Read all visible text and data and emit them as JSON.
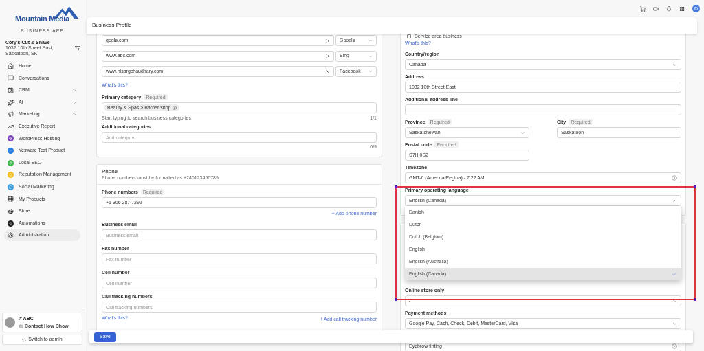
{
  "topbar": {
    "avatar": "D"
  },
  "sidebar": {
    "brand": "Mountain Media",
    "tagline": "BUSINESS APP",
    "account": {
      "name": "Cory's Cut & Shave",
      "address": "1032 10th Street East, Saskatoon, SK"
    },
    "items": [
      {
        "label": "Home",
        "expandable": false,
        "selected": false
      },
      {
        "label": "Conversations",
        "expandable": false,
        "selected": false
      },
      {
        "label": "CRM",
        "expandable": true,
        "selected": false
      },
      {
        "label": "AI",
        "expandable": true,
        "selected": false
      },
      {
        "label": "Marketing",
        "expandable": true,
        "selected": false
      },
      {
        "label": "Executive Report",
        "expandable": false,
        "selected": false
      },
      {
        "label": "WordPress Hosting",
        "expandable": false,
        "selected": false
      },
      {
        "label": "Yesware Test Product",
        "expandable": false,
        "selected": false
      },
      {
        "label": "Local SEO",
        "expandable": false,
        "selected": false
      },
      {
        "label": "Reputation Management",
        "expandable": false,
        "selected": false
      },
      {
        "label": "Social Marketing",
        "expandable": false,
        "selected": false
      },
      {
        "label": "My Products",
        "expandable": false,
        "selected": false
      },
      {
        "label": "Store",
        "expandable": false,
        "selected": false
      },
      {
        "label": "Automations",
        "expandable": false,
        "selected": false
      },
      {
        "label": "Administration",
        "expandable": false,
        "selected": true
      }
    ],
    "user": {
      "name": "# ABC",
      "contact": "Contact How Chow"
    },
    "switch_button": "Switch to admin"
  },
  "page_title": "Business Profile",
  "left_column": {
    "links": [
      {
        "url": "gogle.com",
        "source": "Google"
      },
      {
        "url": "www.abc.com",
        "source": "Bing"
      },
      {
        "url": "www.nisargchaudhary.com",
        "source": "Facebook"
      }
    ],
    "links_help": "What's this?",
    "primary_category": {
      "label": "Primary category",
      "badge": "Required",
      "chips": [
        "Beauty & Spas > Barber shop"
      ],
      "hint": "Start typing to search business categories",
      "count": "1/1"
    },
    "additional_categories": {
      "label": "Additional categories",
      "placeholder": "Add category...",
      "count": "0/9"
    },
    "phone": {
      "title": "Phone",
      "subtitle": "Phone numbers must be formatted as +246123456789",
      "fields": [
        {
          "kind": "input",
          "label": "Phone numbers",
          "badge": "Required",
          "value": "+1 306 287 7292",
          "action": "+ Add phone number"
        },
        {
          "kind": "input",
          "label": "Business email",
          "placeholder": "Business email"
        },
        {
          "kind": "input",
          "label": "Fax number",
          "placeholder": "Fax number"
        },
        {
          "kind": "input",
          "label": "Cell number",
          "placeholder": "Cell number"
        },
        {
          "kind": "input",
          "label": "Call tracking numbers",
          "placeholder": "Call tracking numbers"
        }
      ],
      "help": "What's this?",
      "action": "+ Add call tracking number"
    }
  },
  "right_column": {
    "service_area": {
      "label": "Service area business",
      "checked": false
    },
    "help": "What's this?",
    "fields": [
      {
        "kind": "select",
        "label": "Country/region",
        "value": "Canada"
      },
      {
        "kind": "input",
        "label": "Address",
        "value": "1032 10th Street East"
      },
      {
        "kind": "input",
        "label": "Additional address line"
      },
      {
        "kind": "row",
        "fields": [
          {
            "kind": "select",
            "label": "Province",
            "badge": "Required",
            "value": "Saskatchewan"
          },
          {
            "kind": "input",
            "label": "City",
            "badge": "Required",
            "value": "Saskatoon"
          }
        ]
      },
      {
        "kind": "row",
        "fields": [
          {
            "kind": "input",
            "label": "Postal code",
            "badge": "Required",
            "value": "S7H 0S2"
          }
        ]
      },
      {
        "kind": "clearable",
        "label": "Timezone",
        "value": "GMT-6 (America/Regina) - 7:22 AM"
      },
      {
        "kind": "select",
        "label": "Primary operating language",
        "value": "English (Canada)",
        "expanded": true,
        "options": [
          {
            "label": "Danish",
            "selected": false
          },
          {
            "label": "Dutch",
            "selected": false
          },
          {
            "label": "Dutch (Belgium)",
            "selected": false
          },
          {
            "label": "English",
            "selected": false
          },
          {
            "label": "English (Australia)",
            "selected": false
          },
          {
            "label": "English (Canada)",
            "selected": true
          }
        ]
      }
    ],
    "second_card": [
      {
        "kind": "select",
        "label": "Online store only",
        "value": "-"
      },
      {
        "kind": "select",
        "label": "Payment methods",
        "value": "Google Pay, Cash, Check, Debit, MasterCard, Visa"
      },
      {
        "kind": "clearable",
        "value": "Eyebrow tinting"
      }
    ]
  },
  "save_button": "Save"
}
